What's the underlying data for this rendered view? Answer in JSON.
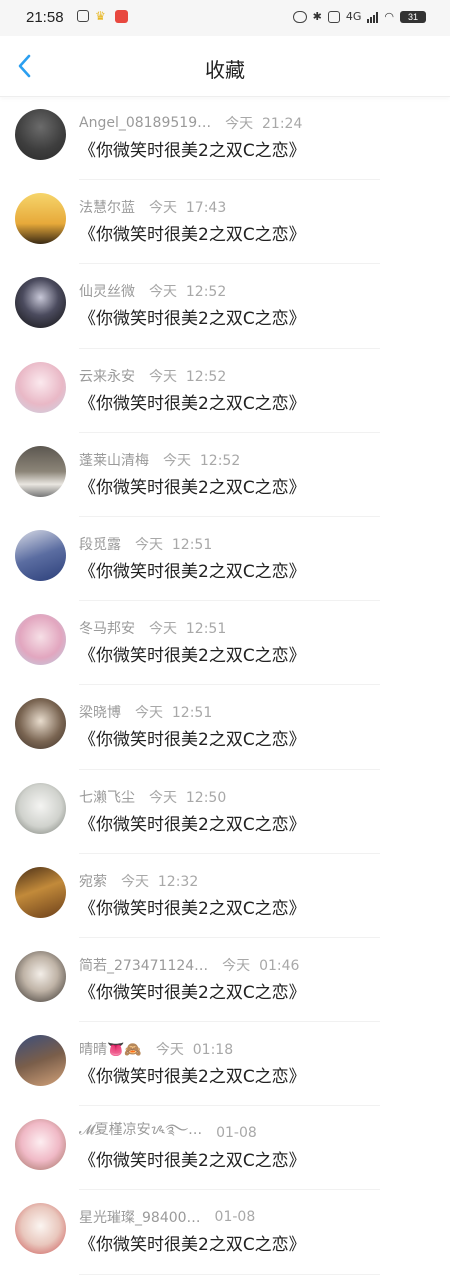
{
  "status_bar": {
    "time": "21:58",
    "battery": "31",
    "network": "4G"
  },
  "header": {
    "title": "收藏",
    "back_icon": "chevron-left-icon"
  },
  "colors": {
    "accent": "#2b9ff0",
    "text_primary": "#222222",
    "text_secondary": "#9a9a9a"
  },
  "favorites": [
    {
      "name": "Angel_08189519…",
      "time": "今天  21:24",
      "title": "《你微笑时很美2之双C之恋》",
      "avatar_icon": "avatar-dark-figure"
    },
    {
      "name": "法慧尔蓝",
      "time": "今天  17:43",
      "title": "《你微笑时很美2之双C之恋》",
      "avatar_icon": "avatar-eiffel-tower"
    },
    {
      "name": "仙灵丝微",
      "time": "今天  12:52",
      "title": "《你微笑时很美2之双C之恋》",
      "avatar_icon": "avatar-dark-photo"
    },
    {
      "name": "云来永安",
      "time": "今天  12:52",
      "title": "《你微笑时很美2之双C之恋》",
      "avatar_icon": "avatar-girl-pink"
    },
    {
      "name": "蓬莱山清梅",
      "time": "今天  12:52",
      "title": "《你微笑时很美2之双C之恋》",
      "avatar_icon": "avatar-car"
    },
    {
      "name": "段觅露",
      "time": "今天  12:51",
      "title": "《你微笑时很美2之双C之恋》",
      "avatar_icon": "avatar-blue-figure"
    },
    {
      "name": "冬马邦安",
      "time": "今天  12:51",
      "title": "《你微笑时很美2之双C之恋》",
      "avatar_icon": "avatar-girl-flowers"
    },
    {
      "name": "梁晓博",
      "time": "今天  12:51",
      "title": "《你微笑时很美2之双C之恋》",
      "avatar_icon": "avatar-girl-dark-hair"
    },
    {
      "name": "七濑飞尘",
      "time": "今天  12:50",
      "title": "《你微笑时很美2之双C之恋》",
      "avatar_icon": "avatar-ink-figure"
    },
    {
      "name": "宛萦",
      "time": "今天  12:32",
      "title": "《你微笑时很美2之双C之恋》",
      "avatar_icon": "avatar-bookshelf"
    },
    {
      "name": "简若_273471124…",
      "time": "今天  01:46",
      "title": "《你微笑时很美2之双C之恋》",
      "avatar_icon": "avatar-anime-group"
    },
    {
      "name": "晴晴👅🙈",
      "time": "今天  01:18",
      "title": "《你微笑时很美2之双C之恋》",
      "avatar_icon": "avatar-group-photo"
    },
    {
      "name": "𝓜夏槿凉安ᝰ࿐…",
      "time": "01-08",
      "title": "《你微笑时很美2之双C之恋》",
      "avatar_icon": "avatar-anime-girl"
    },
    {
      "name": "星光璀璨_98400…",
      "time": "01-08",
      "title": "《你微笑时很美2之双C之恋》",
      "avatar_icon": "avatar-girl-hat"
    }
  ]
}
